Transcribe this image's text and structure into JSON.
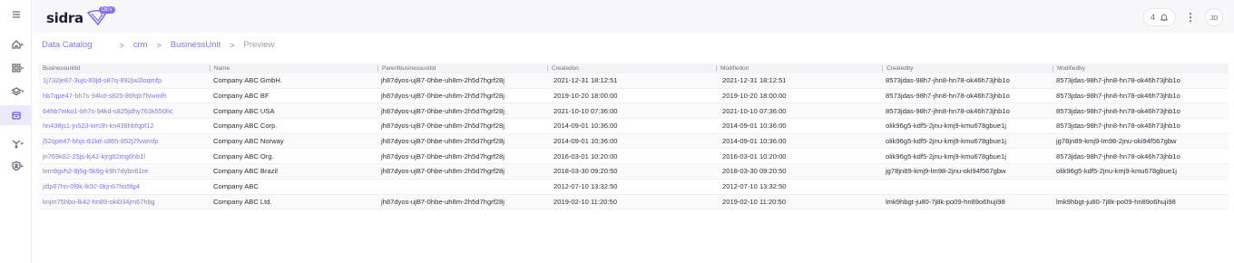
{
  "topbar": {
    "logo_text": "sidra",
    "logo_badge": "DEV",
    "notification_count": "4",
    "user_initials": "JD"
  },
  "breadcrumb": {
    "items": [
      "Data Catalog",
      "crm",
      "BusinessUnit",
      "Preview"
    ]
  },
  "table": {
    "columns": [
      "Businessunitid",
      "Name",
      "Parentbusinessunitid",
      "Createdon",
      "Modifiedon",
      "Createdby",
      "Modifiedby"
    ],
    "rows": [
      [
        "1j732je87-3ujs-83jd-s87q-892jw2loqmfp",
        "Company ABC GmbH.",
        "jh87dyos-ujB7-0hbe-uh8m-2h5d7hgrf28j",
        "2021-12-31 18:12:51",
        "2021-12-31 18:12:51",
        "8573jdas-98h7-jhn8-hn78-ok46h73jhb1o",
        "8573jdas-98h7-jhn8-hn78-ok46h73jhb1o"
      ],
      [
        "hb7qpe47-bh7s-94kd-s825-86fqb7fvwmlh",
        "Company ABC BF",
        "jh87dyos-ujB7-0hbe-uh8m-2h5d7hgrf28j",
        "2019-10-20 18:00:00",
        "2019-10-20 18:00:00",
        "8573jdas-98h7-jhn8-hn78-ok46h73jhb1o",
        "8573jdas-98h7-jhn8-hn78-ok46h73jhb1o"
      ],
      [
        "64hb7mko1-bh7s-94kd-s825jdhy763k550hc",
        "Company ABC USA",
        "jh87dyos-ujB7-0hbe-uh8m-2h5d7hgrf28j",
        "2021-10-10 07:36:00",
        "2021-10-10 07:36:00",
        "8573jdas-98h7-jhn8-hn78-ok46h73jhb1o",
        "8573jdas-98h7-jhn8-hn78-ok46h73jhb1o"
      ],
      [
        "hn438js1-jn523-km3h-kn438hbfqpf12",
        "Company ABC Corp.",
        "jh87dyos-ujB7-0hbe-uh8m-2h5d7hgrf28j",
        "2014-09-01 10:36:00",
        "2014-09-01 10:36:00",
        "olik96g5-kdf5-2jnu-kmj9-kmu678gbue1j",
        "8573jdas-98h7-jhn8-hn78-ok46h73jhb1o"
      ],
      [
        "j52qpe47-bhjs-81kd-s86h-852j7fvwmfp",
        "Company ABC Norway",
        "jh87dyos-ujB7-0hbe-uh8m-2h5d7hgrf28j",
        "2014-09-01 10:36:00",
        "2014-09-01 10:36:00",
        "olik96g5-kdf5-2jnu-kmj9-kmu678gbue1j",
        "jg78jn89-kmj9-lm98-2jnu-oki94f567gbw"
      ],
      [
        "jn769k82-25js-kj42-kjrg62mg6hb1l",
        "Company ABC Org.",
        "jh87dyos-ujB7-0hbe-uh8m-2h5d7hgrf28j",
        "2016-03-01 10:20:00",
        "2016-03-01 10:20:00",
        "olik96g5-kdf5-2jnu-kmj9-kmu678gbue1j",
        "8573jdas-98h7-jhn8-hn78-ok46h73jhb1o"
      ],
      [
        "lom9gvh2-8j5g-5k9g-k9h7dybn61re",
        "Company ABC Brazil",
        "jh87dyos-ujB7-0hbe-uh8m-2h5d7hgrf28j",
        "2018-03-30 09:20:50",
        "2018-03-30 09:20:50",
        "jg78jn89-kmj9-lm98-2jnu-oki94f567gbw",
        "olik96g5-kdf5-2jnu-kmj9-kmu678gbue1j"
      ],
      [
        "jdlp87hn-0l9k-lk92-0kjn67hn5fg4",
        "Company ABC",
        "",
        "2012-07-10 13:32:50",
        "2012-07-10 13:32:50",
        "",
        ""
      ],
      [
        "knjm75hbo-lk42-hn89-oki034jm67hbg",
        "Company ABC Ltd.",
        "jh87dyos-ujB7-0hbe-uh8m-2h5d7hgrf28j",
        "2019-02-10 11:20:50",
        "2019-02-10 11:20:50",
        "lmk9hbgt-ju80-7j8k-po09-hn89o6huji98",
        "lmk9hbgt-ju80-7j8k-po09-hn89o6huji98"
      ]
    ]
  },
  "colors": {
    "accent": "#8c73e8",
    "rail_active": "#ece9fb",
    "topbar_bg": "#f7f7fa"
  }
}
